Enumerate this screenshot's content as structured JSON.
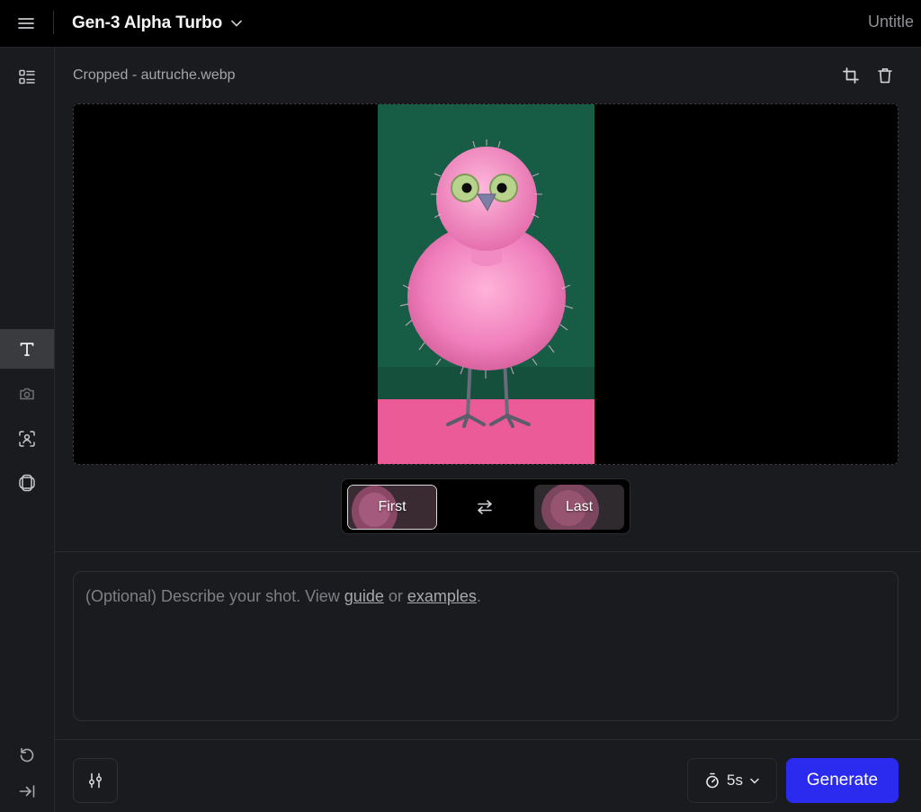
{
  "topbar": {
    "menu_icon": "hamburger-icon",
    "model_name": "Gen-3 Alpha Turbo",
    "model_dropdown_icon": "chevron-down-icon",
    "document_title": "Untitle"
  },
  "sidebar": {
    "items": [
      {
        "name": "assets",
        "icon": "list-grid-icon"
      },
      {
        "name": "text-to-video",
        "icon": "text-t-icon",
        "active": true
      },
      {
        "name": "camera",
        "icon": "camera-icon"
      },
      {
        "name": "subject",
        "icon": "person-focus-icon"
      },
      {
        "name": "frames",
        "icon": "frames-icon"
      }
    ],
    "bottom": [
      {
        "name": "history",
        "icon": "undo-icon"
      },
      {
        "name": "collapse",
        "icon": "collapse-right-icon"
      }
    ]
  },
  "main": {
    "file_name": "Cropped - autruche.webp",
    "crop_icon": "crop-icon",
    "delete_icon": "trash-icon",
    "frame_toggle": {
      "first_label": "First",
      "swap_icon": "swap-arrows-icon",
      "last_label": "Last"
    },
    "prompt": {
      "prefix": "(Optional) Describe your shot. View ",
      "guide_link": "guide",
      "middle": " or ",
      "examples_link": "examples",
      "suffix": "."
    },
    "settings_icon": "sliders-icon",
    "duration": {
      "icon": "timer-icon",
      "value": "5s",
      "dropdown_icon": "chevron-down-icon"
    },
    "generate_label": "Generate"
  },
  "colors": {
    "accent": "#2b2bf0",
    "background": "#1a1b1e",
    "topbar": "#000000",
    "preview_bg_green": "#175c45",
    "preview_floor_pink": "#ea5b97",
    "bird_pink": "#f08cc0"
  }
}
